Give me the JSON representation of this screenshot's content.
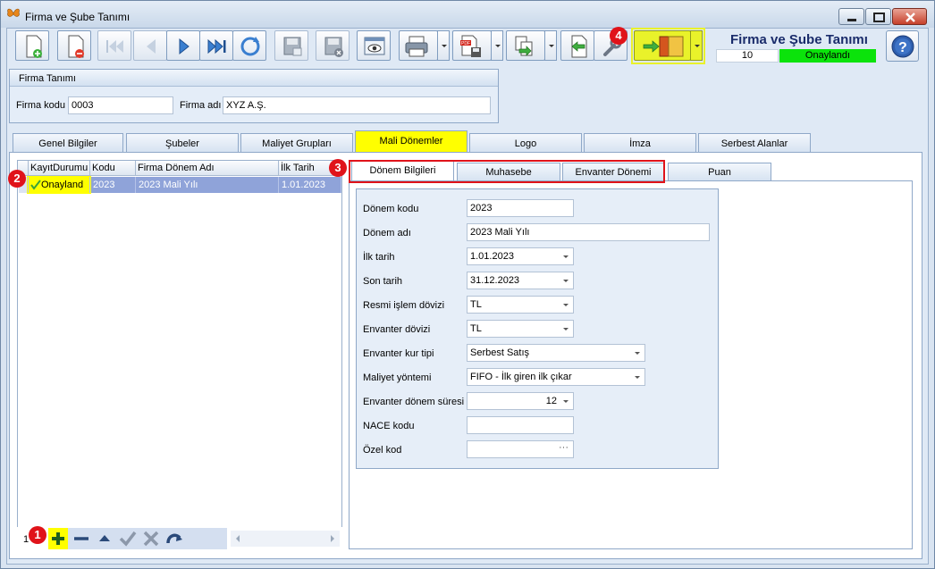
{
  "window": {
    "title": "Firma ve Şube Tanımı"
  },
  "header": {
    "title": "Firma ve Şube Tanımı",
    "code": "10",
    "status": "Onaylandı",
    "status_color": "#0be30b"
  },
  "toolbar": {
    "buttons": [
      "new-record-icon",
      "delete-record-icon",
      "first-record-icon",
      "previous-record-icon",
      "next-record-icon",
      "last-record-icon",
      "refresh-icon",
      "save-icon",
      "save-close-icon",
      "preview-icon",
      "print-icon",
      "pdf-save-icon",
      "export-icon",
      "back-icon",
      "tools-icon",
      "exit-door-icon"
    ]
  },
  "firma": {
    "group_title": "Firma Tanımı",
    "code_label": "Firma kodu",
    "code_value": "0003",
    "name_label": "Firma adı",
    "name_value": "XYZ A.Ş."
  },
  "main_tabs": [
    "Genel Bilgiler",
    "Şubeler",
    "Maliyet Grupları",
    "Mali Dönemler",
    "Logo",
    "İmza",
    "Serbest Alanlar"
  ],
  "grid": {
    "columns": [
      "KayıtDurumu",
      "Kodu",
      "Firma Dönem Adı",
      "İlk Tarih"
    ],
    "rows": [
      {
        "status": "Onayland",
        "code": "2023",
        "name": "2023 Mali Yılı",
        "start": "1.01.2023"
      }
    ],
    "record_count": "1"
  },
  "inner_tabs": [
    "Dönem Bilgileri",
    "Muhasebe",
    "Envanter Dönemi",
    "Puan"
  ],
  "fields": {
    "donem_kodu": {
      "label": "Dönem kodu",
      "value": "2023"
    },
    "donem_adi": {
      "label": "Dönem adı",
      "value": "2023 Mali Yılı"
    },
    "ilk_tarih": {
      "label": "İlk tarih",
      "value": "1.01.2023"
    },
    "son_tarih": {
      "label": "Son tarih",
      "value": "31.12.2023"
    },
    "resmi_doviz": {
      "label": "Resmi işlem dövizi",
      "value": "TL"
    },
    "envanter_doviz": {
      "label": "Envanter dövizi",
      "value": "TL"
    },
    "kur_tipi": {
      "label": "Envanter kur tipi",
      "value": "Serbest Satış"
    },
    "maliyet": {
      "label": "Maliyet yöntemi",
      "value": "FIFO - İlk giren ilk çıkar"
    },
    "sure": {
      "label": "Envanter dönem süresi",
      "value": "12"
    },
    "nace": {
      "label": "NACE kodu",
      "value": ""
    },
    "ozel": {
      "label": "Özel kod",
      "value": ""
    }
  },
  "annotations": [
    "1",
    "2",
    "3",
    "4"
  ],
  "colors": {
    "highlight": "#ffff00",
    "annotation": "#e0131a",
    "selected_row": "#8fa3d9"
  }
}
